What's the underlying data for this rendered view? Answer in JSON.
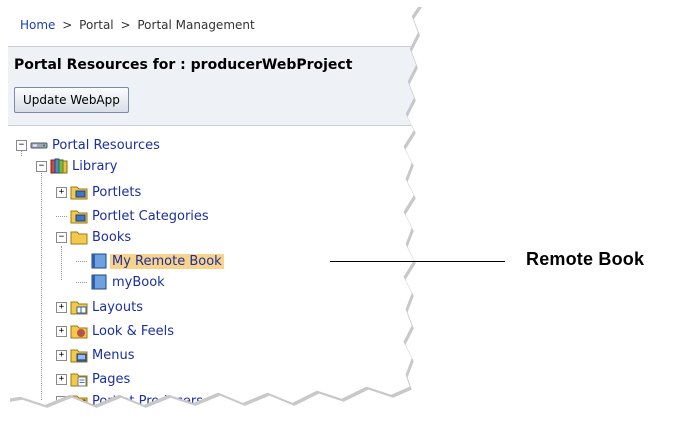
{
  "breadcrumb": {
    "home": "Home",
    "separator": ">",
    "portal": "Portal",
    "management": "Portal Management"
  },
  "header": {
    "title": "Portal Resources for : producerWebProject",
    "update_button": "Update WebApp"
  },
  "tree": {
    "root": "Portal Resources",
    "library": "Library",
    "portlets": "Portlets",
    "portlet_categories": "Portlet Categories",
    "books": "Books",
    "my_remote_book": "My Remote Book",
    "mybook": "myBook",
    "layouts": "Layouts",
    "look_feels": "Look & Feels",
    "menus": "Menus",
    "pages": "Pages",
    "portlet_producers": "Portlet Producers"
  },
  "toggles": {
    "collapsed": "+",
    "expanded": "−"
  },
  "callout": {
    "label": "Remote Book"
  },
  "colors": {
    "link": "#1b2f9e",
    "selected_bg": "#f7d38c",
    "header_bg": "#eef1f6"
  }
}
